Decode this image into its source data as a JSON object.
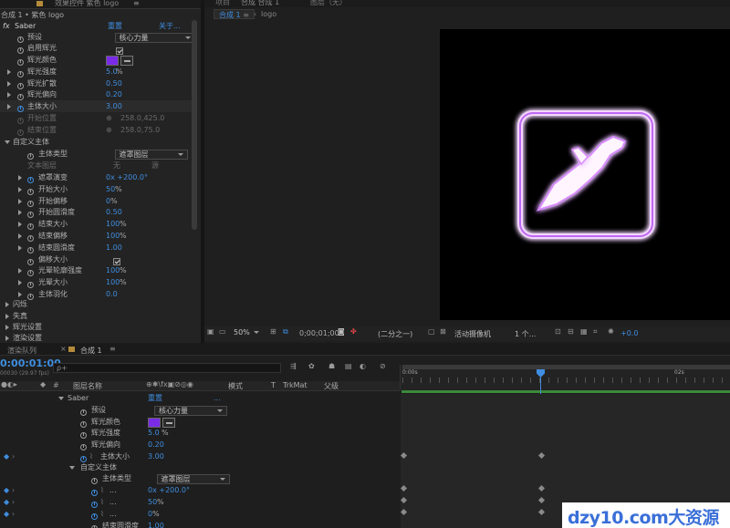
{
  "colors": {
    "accent": "#3f8ee0",
    "purple_swatch": "#7a2be6",
    "playhead": "#3f8ee0",
    "work_area": "#3a8a3a"
  },
  "top_left": {
    "tab_text": "效果控件 紫色 logo",
    "breadcrumb": "合成 1 • 紫色 logo",
    "fx_label": "fx",
    "effect_name": "Saber",
    "reset": "重置",
    "about": "关于..."
  },
  "effect_rows": [
    {
      "label": "预设",
      "value": "核心力量",
      "kind": "drop"
    },
    {
      "label": "启用辉光",
      "value": "",
      "kind": "check"
    },
    {
      "label": "辉光颜色",
      "value": "",
      "kind": "color"
    },
    {
      "label": "辉光强度",
      "value": "5.0",
      "unit": "%",
      "kind": "num"
    },
    {
      "label": "辉光扩散",
      "value": "0.50",
      "kind": "num"
    },
    {
      "label": "辉光偏向",
      "value": "0.20",
      "kind": "num"
    },
    {
      "label": "主体大小",
      "value": "3.00",
      "kind": "num"
    },
    {
      "label": "开始位置",
      "value": "258.0,425.0",
      "kind": "dim"
    },
    {
      "label": "结束位置",
      "value": "258.0,75.0",
      "kind": "dim"
    }
  ],
  "custom_body": {
    "header": "自定义主体",
    "type_label": "主体类型",
    "type_value": "遮罩图层",
    "text_layer_label": "文本图层",
    "text_layer_value": "无",
    "text_layer_value2": "源",
    "rows": [
      {
        "label": "遮罩演变",
        "value": "0x +200.0°"
      },
      {
        "label": "开始大小",
        "value": "50",
        "unit": "%"
      },
      {
        "label": "开始偏移",
        "value": "0",
        "unit": "%"
      },
      {
        "label": "开始圆滑度",
        "value": "0.50"
      },
      {
        "label": "结束大小",
        "value": "100",
        "unit": "%"
      },
      {
        "label": "结束偏移",
        "value": "100",
        "unit": "%"
      },
      {
        "label": "结束圆滑度",
        "value": "1.00"
      },
      {
        "label": "偏移大小",
        "value": "",
        "kind": "check"
      },
      {
        "label": "光晕轮廓强度",
        "value": "100",
        "unit": "%"
      },
      {
        "label": "光晕大小",
        "value": "100",
        "unit": "%"
      },
      {
        "label": "主体羽化",
        "value": "0.0"
      }
    ]
  },
  "sections_collapsed": [
    "闪烁",
    "失真",
    "辉光设置",
    "渲染设置"
  ],
  "viewer": {
    "tab_project": "项目",
    "tab_comp": "合成 合成 1",
    "tab_layer": "图层（无）",
    "sub_tab": "合成 1",
    "sub_crumb": "logo",
    "zoom": "50%",
    "timecode": "0;00;01;00",
    "resolution": "(二分之一)",
    "camera": "活动摄像机",
    "views": "1 个...",
    "exposure": "+0.0"
  },
  "timeline": {
    "tab_render": "渲染队列",
    "tab_comp": "合成 1",
    "timecode": "0:00:01:00",
    "fps": "00030 (29.97 fps)",
    "search_placeholder": "ρ+",
    "col_layer": "图层名称",
    "col_mode": "模式",
    "col_t": "T",
    "col_trkmat": "TrkMat",
    "col_parent": "父级",
    "ruler_0": "0:00s",
    "ruler_2": "02s",
    "saber": "Saber",
    "reset": "重置",
    "dots": "...",
    "rows": [
      {
        "label": "预设",
        "value": "核心力量",
        "kind": "drop"
      },
      {
        "label": "辉光颜色",
        "value": "",
        "kind": "color"
      },
      {
        "label": "辉光强度",
        "value": "5.0",
        "unit": "%"
      },
      {
        "label": "辉光偏向",
        "value": "0.20"
      },
      {
        "label": "主体大小",
        "value": "3.00",
        "kf": true
      }
    ],
    "custom_header": "自定义主体",
    "custom_type_label": "主体类型",
    "custom_type_value": "遮罩图层",
    "custom_rows": [
      {
        "label": "...",
        "value": "0x +200.0°"
      },
      {
        "label": "...",
        "value": "50",
        "unit": "%"
      },
      {
        "label": "...",
        "value": "0",
        "unit": "%"
      },
      {
        "label": "结束圆滑度",
        "value": "1.00"
      }
    ]
  },
  "watermark": "dzy10.com大资源网"
}
